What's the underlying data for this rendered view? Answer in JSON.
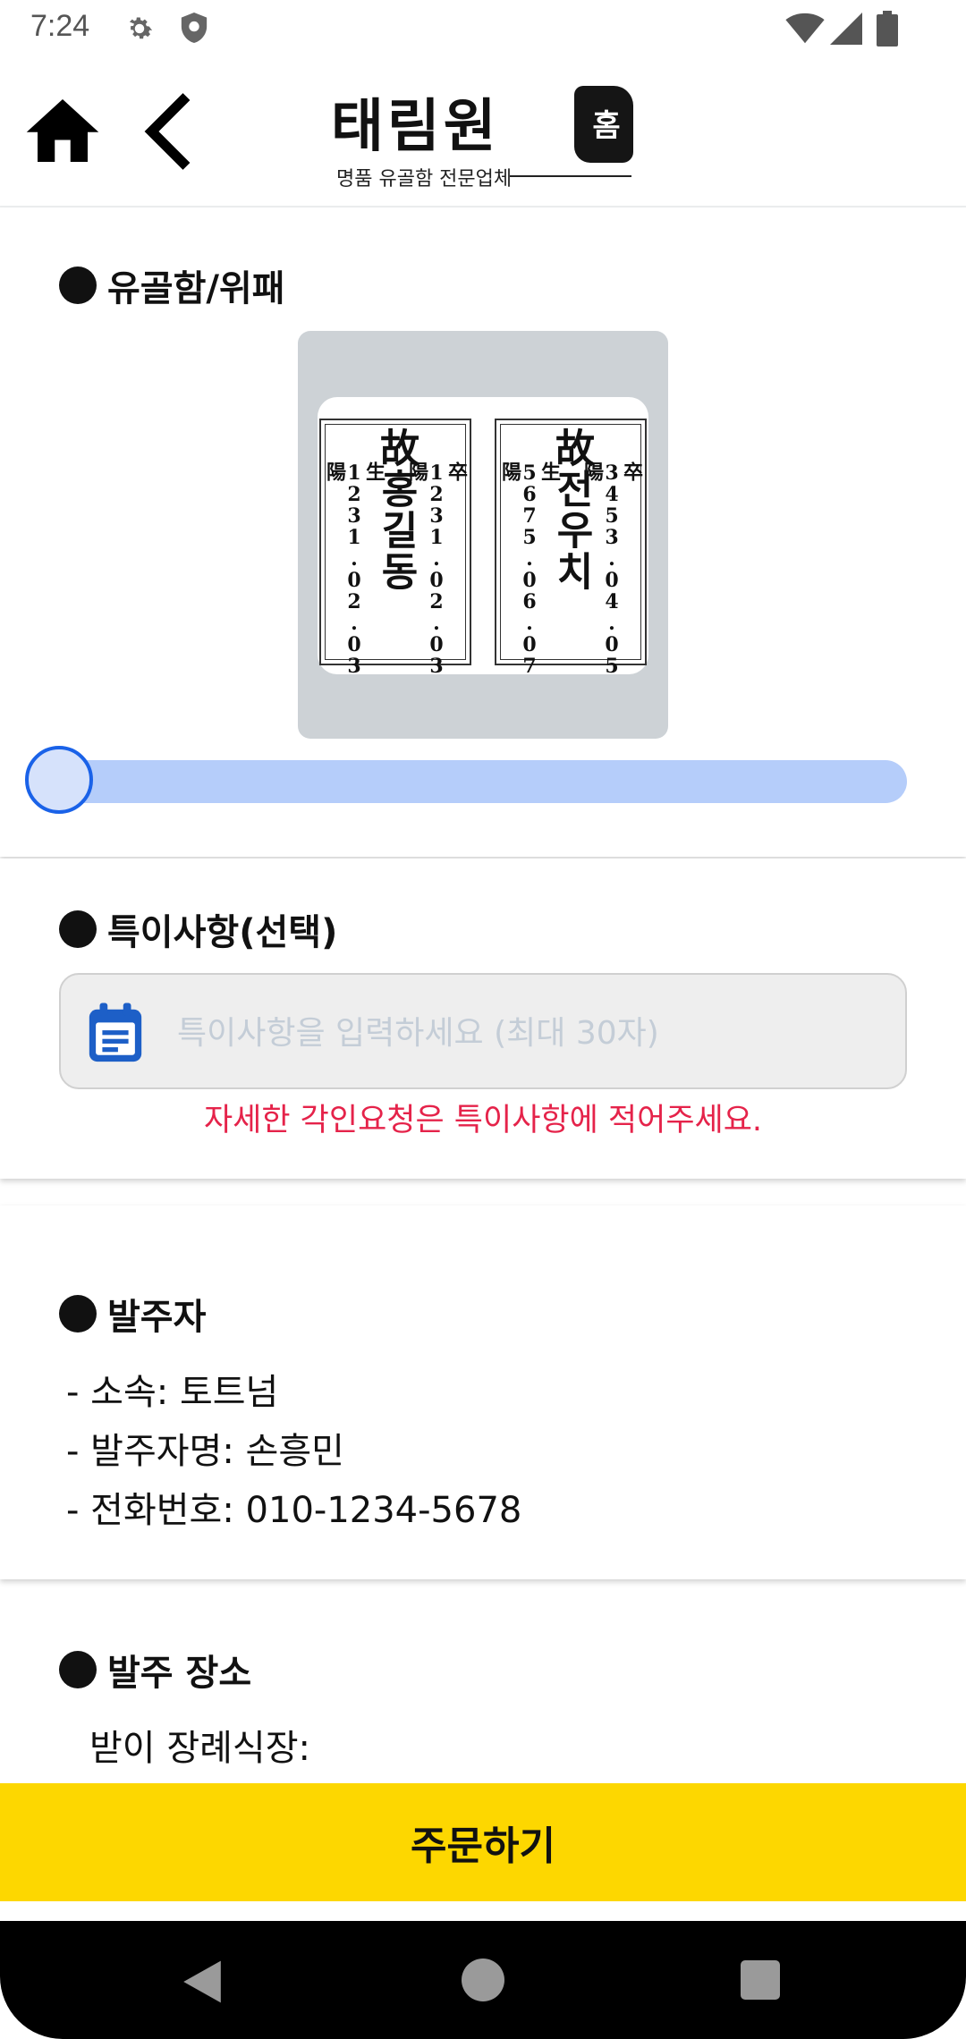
{
  "status_bar": {
    "time": "7:24",
    "icons": [
      "gear-icon",
      "shield-icon",
      "wifi-icon",
      "signal-icon",
      "battery-icon"
    ]
  },
  "header": {
    "home_icon": "home-icon",
    "back_icon": "chevron-left-icon",
    "logo_text": "태림원",
    "logo_seal": "홈",
    "logo_subtitle": "명품 유골함 전문업체"
  },
  "urn_section": {
    "title": "유골함/위패",
    "tablets": [
      {
        "prefix": "故",
        "name": "홍길동",
        "birth": "生1231.02.03陽",
        "death": "卒1231.02.03陽"
      },
      {
        "prefix": "故",
        "name": "전우치",
        "birth": "生5675.06.07陽",
        "death": "卒3453.04.05陽"
      }
    ],
    "slider_value": 0
  },
  "notes_section": {
    "title": "특이사항(선택)",
    "placeholder": "특이사항을 입력하세요 (최대 30자)",
    "value": "",
    "helper": "자세한 각인요청은 특이사항에 적어주세요.",
    "icon": "notepad-icon",
    "helper_color": "#e5234a"
  },
  "orderer_section": {
    "title": "발주자",
    "lines": [
      "- 소속: 토트넘",
      "- 발주자명: 손흥민",
      "- 전화번호: 010-1234-5678"
    ]
  },
  "place_section": {
    "title": "발주 장소",
    "partial_line": "받이 장례식장:"
  },
  "order_button": {
    "label": "주문하기",
    "color": "#fdd700"
  },
  "nav_bar": {
    "icons": [
      "nav-back-icon",
      "nav-home-icon",
      "nav-recents-icon"
    ]
  }
}
